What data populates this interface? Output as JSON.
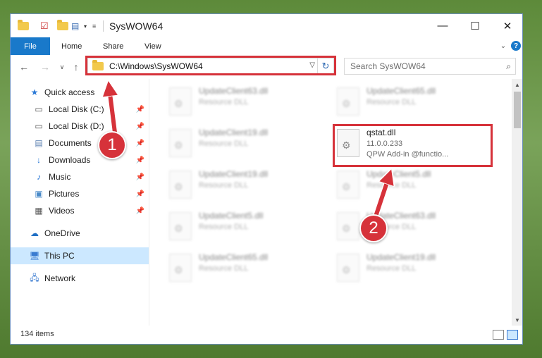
{
  "window": {
    "title": "SysWOW64"
  },
  "window_controls": {
    "minimize": "—",
    "maximize": "☐",
    "close": "✕"
  },
  "ribbon": {
    "tabs": [
      "File",
      "Home",
      "Share",
      "View"
    ]
  },
  "nav": {
    "address": "C:\\Windows\\SysWOW64",
    "search_placeholder": "Search SysWOW64"
  },
  "sidebar": {
    "items": [
      {
        "label": "Quick access",
        "icon": "star-icon",
        "pinned": false
      },
      {
        "label": "Local Disk (C:)",
        "icon": "drive-icon",
        "pinned": true
      },
      {
        "label": "Local Disk (D:)",
        "icon": "drive-icon",
        "pinned": true
      },
      {
        "label": "Documents",
        "icon": "documents-icon",
        "pinned": true
      },
      {
        "label": "Downloads",
        "icon": "download-icon",
        "pinned": true
      },
      {
        "label": "Music",
        "icon": "music-icon",
        "pinned": true
      },
      {
        "label": "Pictures",
        "icon": "pictures-icon",
        "pinned": true
      },
      {
        "label": "Videos",
        "icon": "videos-icon",
        "pinned": true
      },
      {
        "label": "OneDrive",
        "icon": "cloud-icon",
        "pinned": false
      },
      {
        "label": "This PC",
        "icon": "computer-icon",
        "pinned": false,
        "selected": true
      },
      {
        "label": "Network",
        "icon": "network-icon",
        "pinned": false
      }
    ]
  },
  "files": [
    {
      "name": "UpdateClient63.dll",
      "type": "Resource DLL"
    },
    {
      "name": "UpdateClient65.dll",
      "type": "Resource DLL"
    },
    {
      "name": "UpdateClient19.dll",
      "type": "Resource DLL"
    },
    {
      "name": "qstat.dll",
      "version": "11.0.0.233",
      "description": "QPW Add-in @functio...",
      "highlighted": true
    },
    {
      "name": "UpdateClient19.dll",
      "type": "Resource DLL"
    },
    {
      "name": "UpdateClient5.dll",
      "type": "Resource DLL"
    },
    {
      "name": "UpdateClient5.dll",
      "type": "Resource DLL"
    },
    {
      "name": "UpdateClient63.dll",
      "type": "Resource DLL"
    },
    {
      "name": "UpdateClient65.dll",
      "type": "Resource DLL"
    },
    {
      "name": "UpdateClient19.dll",
      "type": "Resource DLL"
    }
  ],
  "status": {
    "item_count": "134 items"
  },
  "annotations": {
    "step1": "1",
    "step2": "2",
    "color": "#d6323a"
  }
}
